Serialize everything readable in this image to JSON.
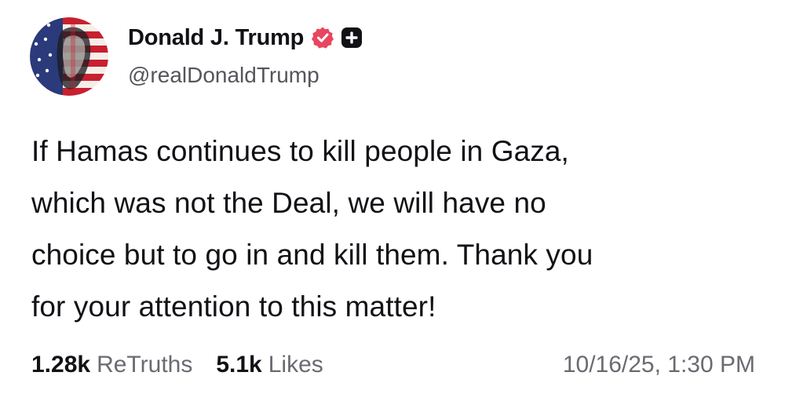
{
  "author": {
    "display_name": "Donald J. Trump",
    "handle": "@realDonaldTrump",
    "avatar_icon": "flag-portrait-avatar",
    "verified_icon": "verified-badge-icon",
    "plus_icon": "plus-badge-icon"
  },
  "post": {
    "lines": [
      "If Hamas continues to kill people in Gaza,",
      "which was not the Deal, we will have no",
      "choice but to go in and kill them. Thank you",
      "for your attention to this matter!"
    ]
  },
  "stats": {
    "retruths_count": "1.28k",
    "retruths_label": "ReTruths",
    "likes_count": "5.1k",
    "likes_label": "Likes"
  },
  "timestamp": "10/16/25, 1:30 PM",
  "colors": {
    "verified": "#e8465f",
    "plus_badge": "#111116",
    "muted_text": "#6a6a72"
  }
}
